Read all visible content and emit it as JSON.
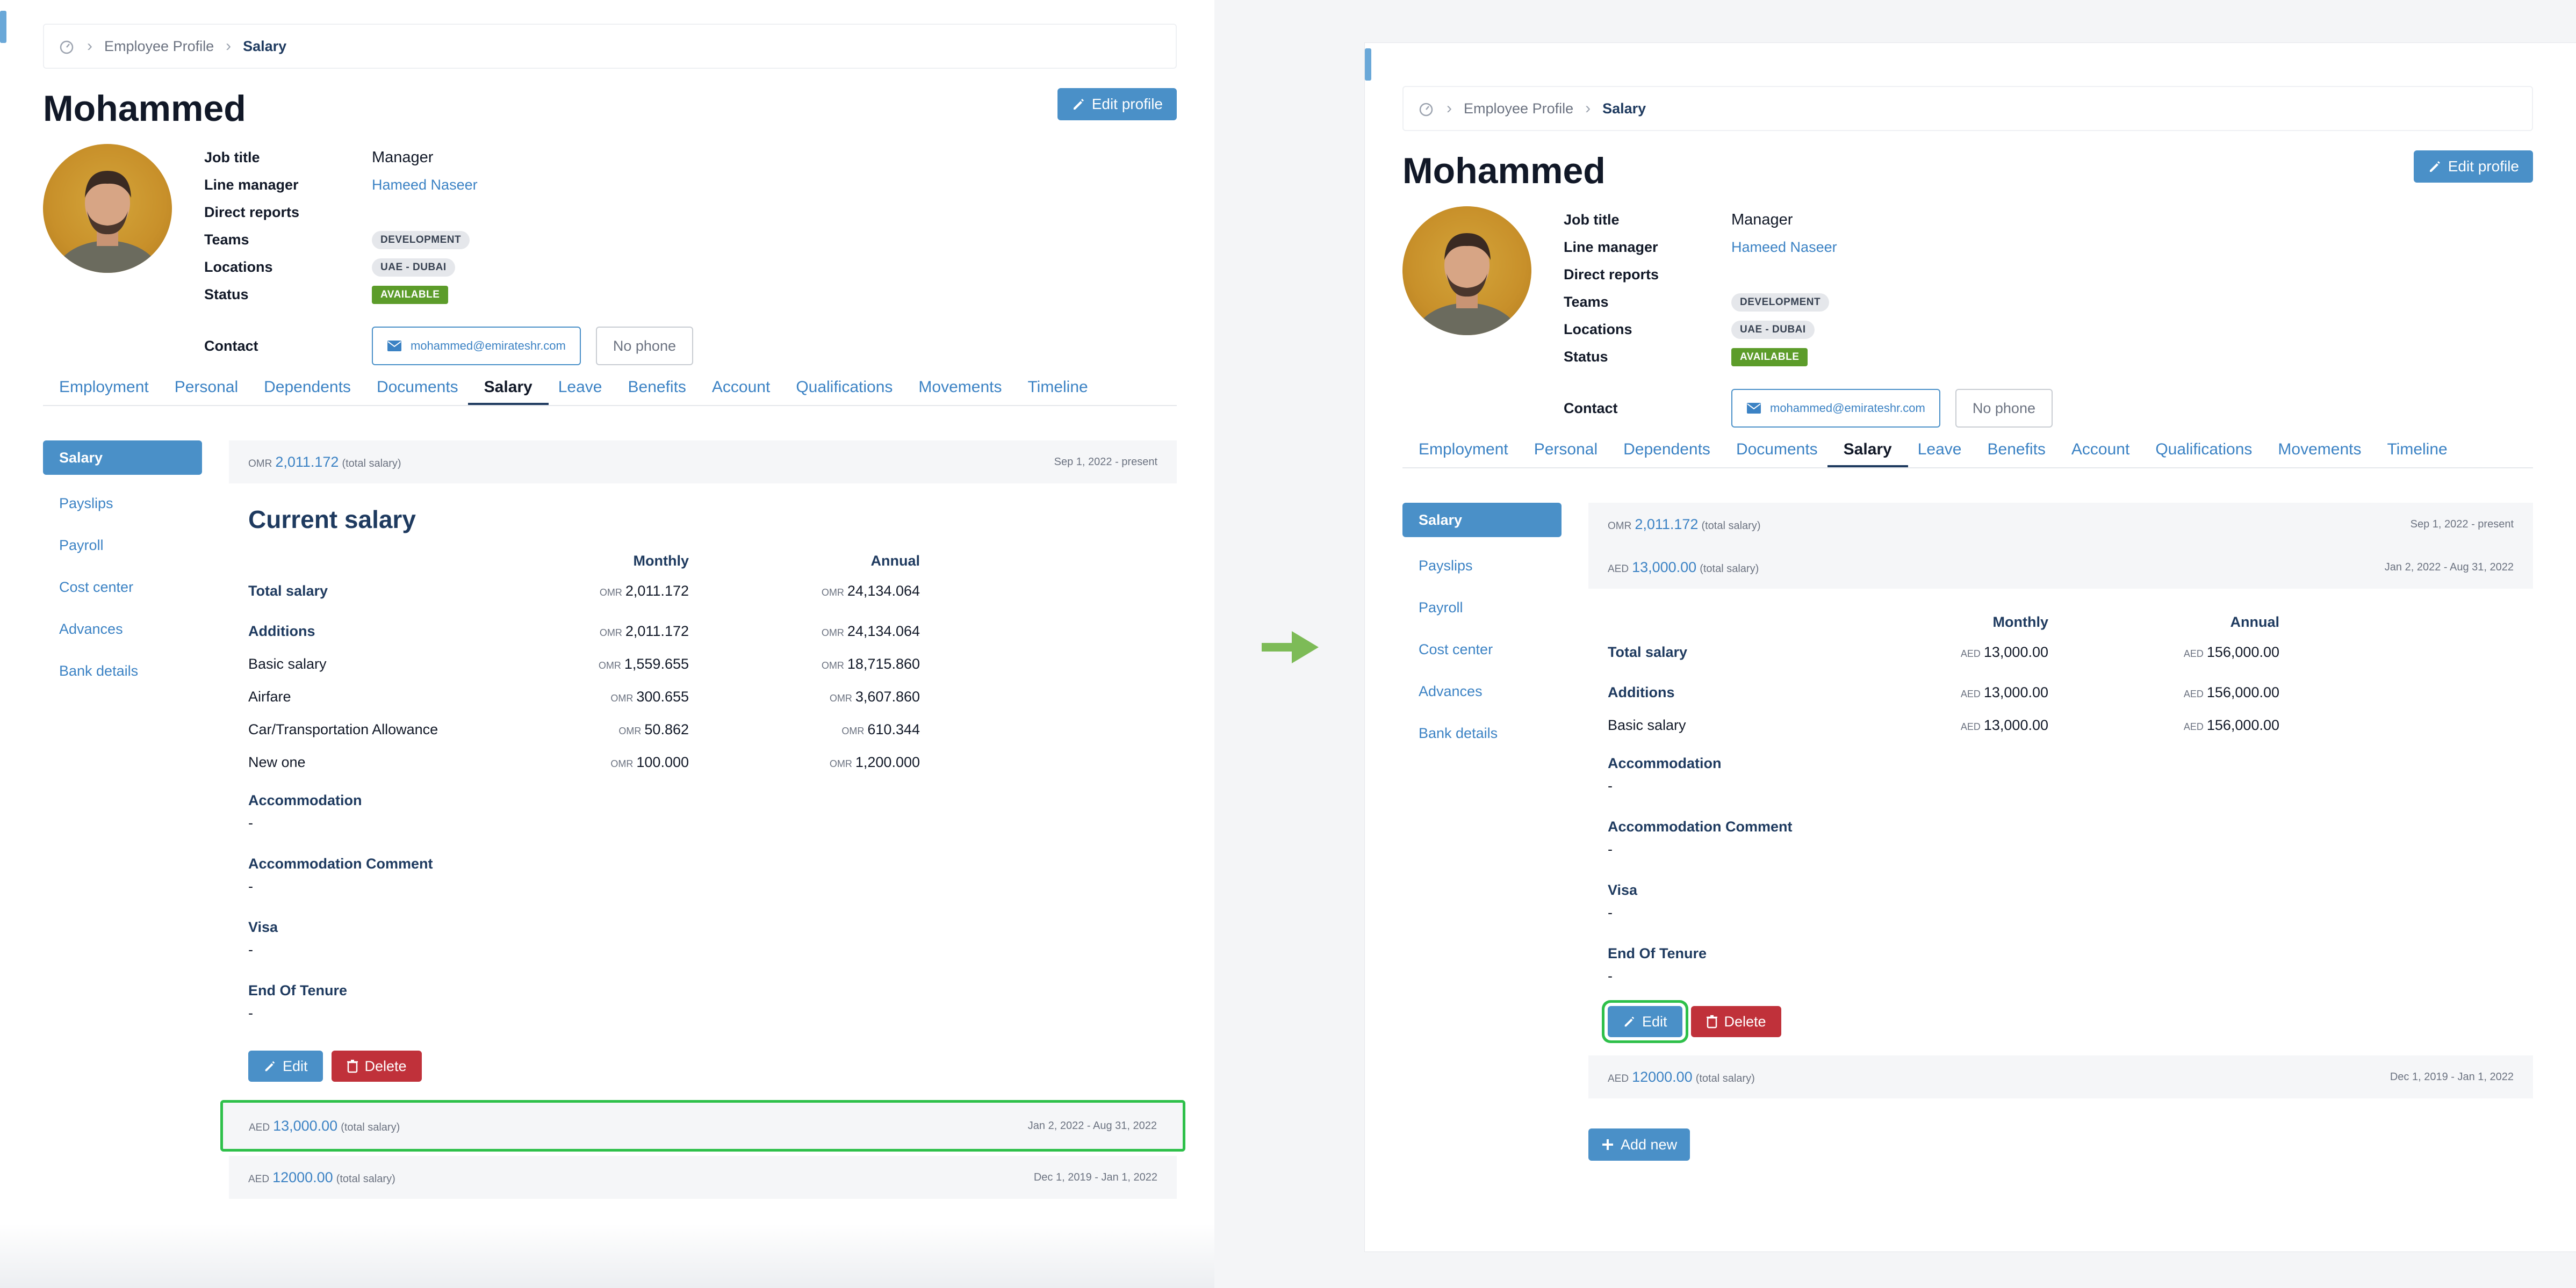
{
  "breadcrumb": {
    "parent": "Employee Profile",
    "current": "Salary"
  },
  "employee": {
    "name": "Mohammed",
    "edit_profile_label": "Edit profile",
    "fields": {
      "job_title_label": "Job title",
      "job_title": "Manager",
      "line_manager_label": "Line manager",
      "line_manager": "Hameed Naseer",
      "direct_reports_label": "Direct reports",
      "teams_label": "Teams",
      "teams": "DEVELOPMENT",
      "locations_label": "Locations",
      "location": "UAE - DUBAI",
      "status_label": "Status",
      "status": "AVAILABLE",
      "contact_label": "Contact",
      "email": "mohammed@emirateshr.com",
      "phone": "No phone"
    }
  },
  "tabs": [
    {
      "label": "Employment"
    },
    {
      "label": "Personal"
    },
    {
      "label": "Dependents"
    },
    {
      "label": "Documents"
    },
    {
      "label": "Salary"
    },
    {
      "label": "Leave"
    },
    {
      "label": "Benefits"
    },
    {
      "label": "Account"
    },
    {
      "label": "Qualifications"
    },
    {
      "label": "Movements"
    },
    {
      "label": "Timeline"
    }
  ],
  "sidenav": [
    "Salary",
    "Payslips",
    "Payroll",
    "Cost center",
    "Advances",
    "Bank details"
  ],
  "salaries": {
    "omr": {
      "currency": "OMR",
      "amount": "2,011.172",
      "suffix": "(total salary)",
      "range": "Sep 1, 2022 - present"
    },
    "aed13": {
      "currency": "AED",
      "amount": "13,000.00",
      "suffix": "(total salary)",
      "range": "Jan 2, 2022 - Aug 31, 2022"
    },
    "aed12": {
      "currency": "AED",
      "amount": "12000.00",
      "suffix": "(total salary)",
      "range": "Dec 1, 2019 - Jan 1, 2022"
    }
  },
  "left_detail": {
    "title": "Current salary",
    "col_monthly": "Monthly",
    "col_annual": "Annual",
    "rows": [
      {
        "label": "Total salary",
        "cur": "OMR",
        "monthly": "2,011.172",
        "annual": "24,134.064"
      },
      {
        "label": "Additions",
        "cur": "OMR",
        "monthly": "2,011.172",
        "annual": "24,134.064"
      },
      {
        "label": "Basic salary",
        "cur": "OMR",
        "monthly": "1,559.655",
        "annual": "18,715.860"
      },
      {
        "label": "Airfare",
        "cur": "OMR",
        "monthly": "300.655",
        "annual": "3,607.860"
      },
      {
        "label": "Car/Transportation Allowance",
        "cur": "OMR",
        "monthly": "50.862",
        "annual": "610.344"
      },
      {
        "label": "New one",
        "cur": "OMR",
        "monthly": "100.000",
        "annual": "1,200.000"
      }
    ]
  },
  "right_detail": {
    "col_monthly": "Monthly",
    "col_annual": "Annual",
    "rows": [
      {
        "label": "Total salary",
        "cur": "AED",
        "monthly": "13,000.00",
        "annual": "156,000.00"
      },
      {
        "label": "Additions",
        "cur": "AED",
        "monthly": "13,000.00",
        "annual": "156,000.00"
      },
      {
        "label": "Basic salary",
        "cur": "AED",
        "monthly": "13,000.00",
        "annual": "156,000.00"
      }
    ]
  },
  "sections": [
    {
      "title": "Accommodation",
      "value": "-"
    },
    {
      "title": "Accommodation Comment",
      "value": "-"
    },
    {
      "title": "Visa",
      "value": "-"
    },
    {
      "title": "End Of Tenure",
      "value": "-"
    }
  ],
  "buttons": {
    "edit": "Edit",
    "delete": "Delete",
    "add_new": "Add new"
  },
  "colors": {
    "primary": "#4a90c8",
    "danger": "#c0313a",
    "success": "#5c9c2a",
    "highlight": "#2ec04a",
    "arrow": "#7dbb57"
  }
}
